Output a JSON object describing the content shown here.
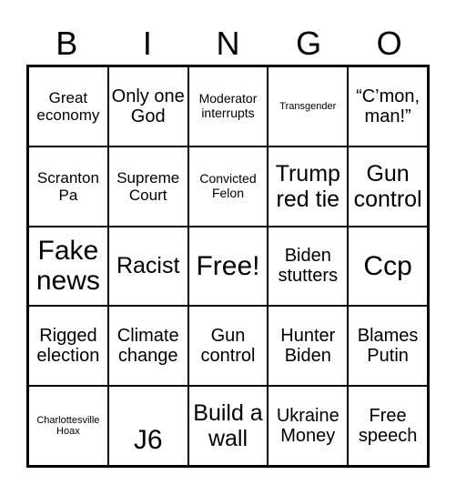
{
  "header": {
    "letters": [
      "B",
      "I",
      "N",
      "G",
      "O"
    ]
  },
  "cells": [
    [
      "Great economy",
      "Only one God",
      "Moderator interrupts",
      "Transgender",
      "“C’mon, man!”"
    ],
    [
      "Scranton Pa",
      "Supreme Court",
      "Convicted Felon",
      "Trump red tie",
      "Gun control"
    ],
    [
      "Fake news",
      "Racist",
      "Free!",
      "Biden stutters",
      "Ccp"
    ],
    [
      "Rigged election",
      "Climate change",
      "Gun control",
      "Hunter Biden",
      "Blames Putin"
    ],
    [
      "Charlottesville Hoax",
      "J6",
      "Build a wall",
      "Ukraine Money",
      "Free speech"
    ]
  ]
}
